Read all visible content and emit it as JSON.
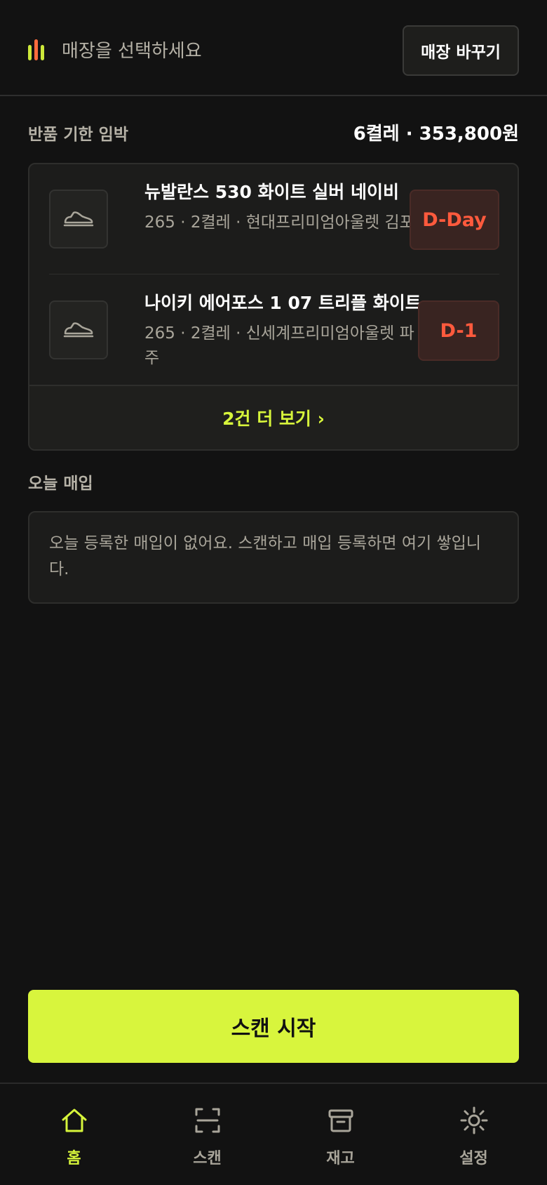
{
  "header": {
    "store_placeholder": "매장을 선택하세요",
    "change_store_label": "매장 바꾸기",
    "brand_colors": [
      "#cde83a",
      "#ff6b3d",
      "#cde83a"
    ]
  },
  "returns": {
    "title": "반품 기한 임박",
    "summary": "6켤레 · 353,800원",
    "items": [
      {
        "name": "뉴발란스 530 화이트 실버 네이비",
        "meta": "265 · 2켤레 · 현대프리미엄아울렛 김포",
        "dday": "D-Day",
        "icon": "shoe-icon"
      },
      {
        "name": "나이키 에어포스 1 07 트리플 화이트",
        "meta": "265 · 2켤레 · 신세계프리미엄아울렛 파주",
        "dday": "D-1",
        "icon": "shoe-icon"
      }
    ],
    "more_label": "2건 더 보기 ›"
  },
  "today": {
    "title": "오늘 매입",
    "empty_text": "오늘 등록한 매입이 없어요. 스캔하고 매입 등록하면 여기 쌓입니다."
  },
  "scan_button_label": "스캔 시작",
  "tabs": [
    {
      "label": "홈",
      "icon": "home-icon",
      "active": true
    },
    {
      "label": "스캔",
      "icon": "scan-icon",
      "active": false
    },
    {
      "label": "재고",
      "icon": "inventory-box-icon",
      "active": false
    },
    {
      "label": "설정",
      "icon": "settings-sun-icon",
      "active": false
    }
  ],
  "colors": {
    "accent": "#d8f53d",
    "danger": "#ff5a3d",
    "background": "#121212"
  }
}
